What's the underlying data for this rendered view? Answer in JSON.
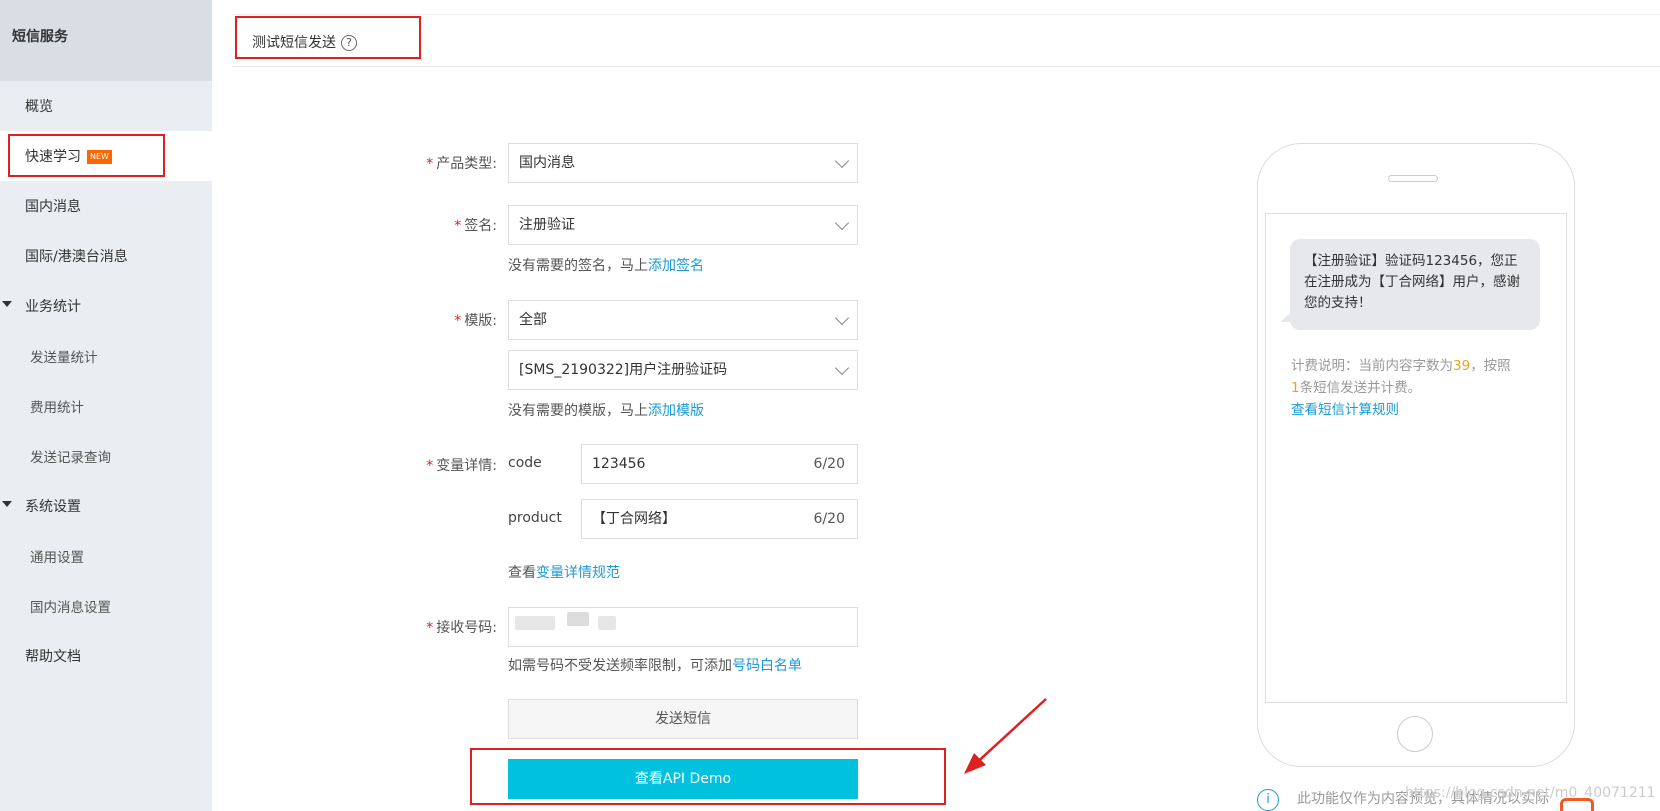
{
  "sidebar": {
    "title": "短信服务",
    "items": {
      "overview": "概览",
      "quick_learn": "快速学习",
      "new_badge": "NEW",
      "domestic": "国内消息",
      "intl": "国际/港澳台消息",
      "stats_group": "业务统计",
      "send_stats": "发送量统计",
      "cost_stats": "费用统计",
      "send_records": "发送记录查询",
      "settings_group": "系统设置",
      "general_settings": "通用设置",
      "domestic_settings": "国内消息设置",
      "help": "帮助文档"
    }
  },
  "header": {
    "title": "测试短信发送",
    "help_icon": "?"
  },
  "form": {
    "required_mark": "*",
    "product_type": {
      "label": "产品类型:",
      "value": "国内消息"
    },
    "signature": {
      "label": "签名:",
      "value": "注册验证",
      "hint_prefix": "没有需要的签名，马上",
      "hint_link": "添加签名"
    },
    "template": {
      "label": "模版:",
      "value": "全部",
      "value2": "[SMS_2190322]用户注册验证码",
      "hint_prefix": "没有需要的模版，马上",
      "hint_link": "添加模版"
    },
    "variables": {
      "label": "变量详情:",
      "code": {
        "name": "code",
        "value": "123456",
        "count": "6/20"
      },
      "product": {
        "name": "product",
        "value": "【丁合网络】",
        "count": "6/20"
      },
      "hint_prefix": "查看",
      "hint_link": "变量详情规范"
    },
    "phone": {
      "label": "接收号码:",
      "hint_prefix": "如需号码不受发送频率限制，可添加",
      "hint_link": "号码白名单"
    },
    "send_button": "发送短信",
    "api_demo_button": "查看API Demo"
  },
  "preview": {
    "message": "【注册验证】验证码123456，您正在注册成为【丁合网络】用户，感谢您的支持！",
    "billing_prefix": "计费说明：当前内容字数为",
    "char_count": "39",
    "billing_mid": "，按照",
    "sms_count": "1",
    "billing_suffix": "条短信发送并计费。",
    "billing_link": "查看短信计算规则",
    "info_icon": "i",
    "info_text": "此功能仅作为内容预览，具体情况以实际",
    "watermark": "https://blog.csdn.net/m0_40071211"
  }
}
